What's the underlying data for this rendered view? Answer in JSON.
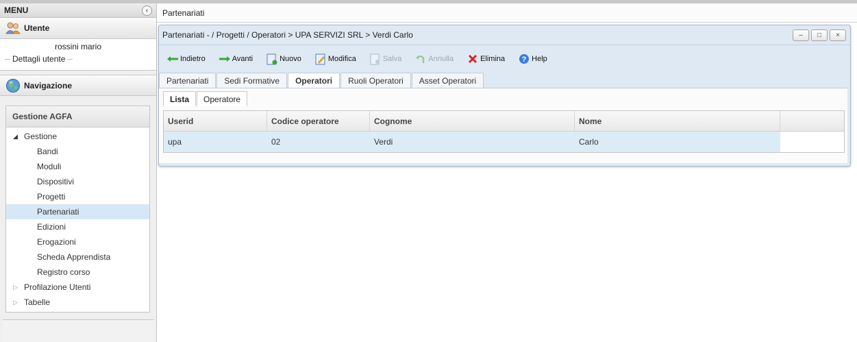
{
  "sidebar": {
    "menu_title": "MENU",
    "utente": {
      "title": "Utente",
      "name": "rossini mario",
      "details_link": "Dettagli utente"
    },
    "navigazione": {
      "title": "Navigazione",
      "tree_title": "Gestione AGFA",
      "items": [
        {
          "label": "Gestione"
        },
        {
          "label": "Bandi"
        },
        {
          "label": "Moduli"
        },
        {
          "label": "Dispositivi"
        },
        {
          "label": "Progetti"
        },
        {
          "label": "Partenariati"
        },
        {
          "label": "Edizioni"
        },
        {
          "label": "Erogazioni"
        },
        {
          "label": "Scheda Apprendista"
        },
        {
          "label": "Registro corso"
        },
        {
          "label": "Profilazione Utenti"
        },
        {
          "label": "Tabelle"
        }
      ]
    }
  },
  "main": {
    "tab_label": "Partenariati",
    "window": {
      "title": "Partenariati - / Progetti / Operatori > UPA SERVIZI SRL > Verdi Carlo",
      "controls": {
        "minimize": "–",
        "maximize": "□",
        "close": "×"
      }
    },
    "toolbar": {
      "back": "Indietro",
      "forward": "Avanti",
      "new": "Nuovo",
      "edit": "Modifica",
      "save": "Salva",
      "cancel": "Annulla",
      "delete": "Elimina",
      "help": "Help"
    },
    "tabs": [
      {
        "label": "Partenariati"
      },
      {
        "label": "Sedi Formative"
      },
      {
        "label": "Operatori"
      },
      {
        "label": "Ruoli Operatori"
      },
      {
        "label": "Asset Operatori"
      }
    ],
    "subtabs": [
      {
        "label": "Lista"
      },
      {
        "label": "Operatore"
      }
    ],
    "grid": {
      "columns": [
        "Userid",
        "Codice operatore",
        "Cognome",
        "Nome"
      ],
      "rows": [
        [
          "upa",
          "02",
          "Verdi",
          "Carlo"
        ]
      ]
    }
  },
  "colors": {
    "selected_row": "#dcecf7",
    "window_bg": "#dfe9f3",
    "tree_selected": "#d6e8f5"
  }
}
